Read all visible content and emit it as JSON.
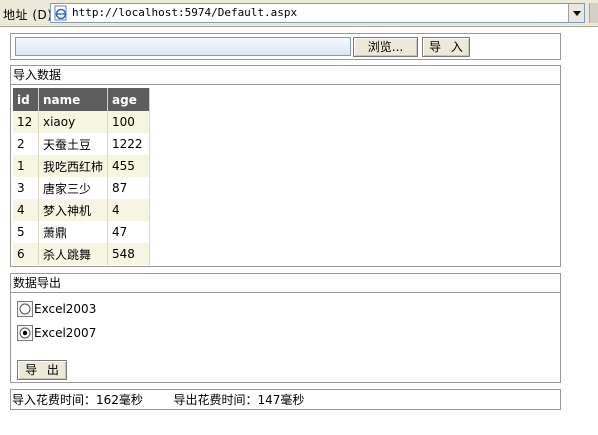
{
  "address_bar": {
    "label": "地址 (D)",
    "url": "http://localhost:5974/Default.aspx"
  },
  "upload": {
    "file_value": "",
    "browse_label": "浏览...",
    "import_label": "导 入"
  },
  "import_panel": {
    "title": "导入数据",
    "columns": [
      "id",
      "name",
      "age"
    ],
    "rows": [
      {
        "id": "12",
        "name": "xiaoy",
        "age": "100"
      },
      {
        "id": "2",
        "name": "天蚕土豆",
        "age": "1222"
      },
      {
        "id": "1",
        "name": "我吃西红柿",
        "age": "455"
      },
      {
        "id": "3",
        "name": "唐家三少",
        "age": "87"
      },
      {
        "id": "4",
        "name": "梦入神机",
        "age": "4"
      },
      {
        "id": "5",
        "name": "萧鼎",
        "age": "47"
      },
      {
        "id": "6",
        "name": "杀人跳舞",
        "age": "548"
      }
    ]
  },
  "export_panel": {
    "title": "数据导出",
    "options": [
      {
        "label": "Excel2003",
        "selected": false
      },
      {
        "label": "Excel2007",
        "selected": true
      }
    ],
    "export_label": "导 出"
  },
  "timing": {
    "import_label": "导入花费时间：",
    "import_value": "162毫秒",
    "export_label": "导出花费时间：",
    "export_value": "147毫秒"
  },
  "colors": {
    "header_bg": "#5d5d5d",
    "row_alt_bg": "#f7f6e3",
    "toolbar_bg": "#ece9d8"
  }
}
